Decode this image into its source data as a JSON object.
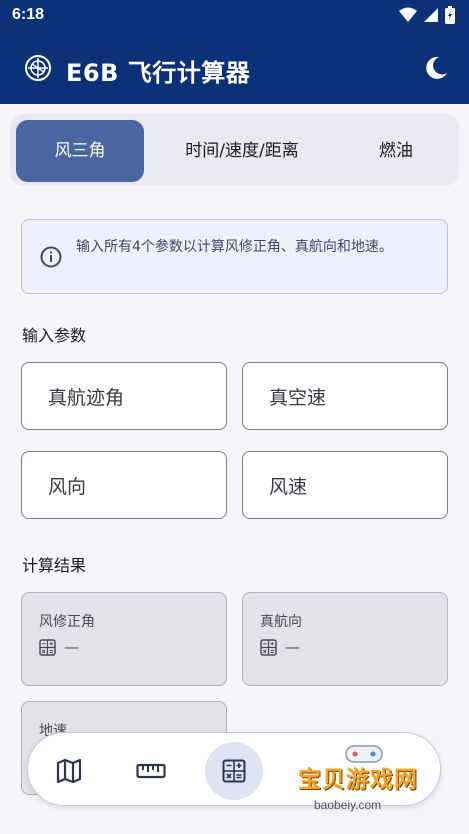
{
  "status_bar": {
    "time": "6:18"
  },
  "app": {
    "title": "E6B 飞行计算器"
  },
  "tabs": [
    {
      "label": "风三角",
      "active": true
    },
    {
      "label": "时间/速度/距离",
      "active": false
    },
    {
      "label": "燃油",
      "active": false
    }
  ],
  "info": {
    "text": "输入所有4个参数以计算风修正角、真航向和地速。"
  },
  "inputs": {
    "section_label": "输入参数",
    "fields": [
      {
        "placeholder": "真航迹角"
      },
      {
        "placeholder": "真空速"
      },
      {
        "placeholder": "风向"
      },
      {
        "placeholder": "风速"
      }
    ]
  },
  "results": {
    "section_label": "计算结果",
    "items": [
      {
        "label": "风修正角",
        "value": "—"
      },
      {
        "label": "真航向",
        "value": "—"
      },
      {
        "label": "地速",
        "value": "—"
      }
    ]
  },
  "bottom_nav": [
    {
      "icon": "map-icon",
      "active": false
    },
    {
      "icon": "ruler-icon",
      "active": false
    },
    {
      "icon": "calculator-icon",
      "active": true
    }
  ],
  "watermark": {
    "text": "宝贝游戏网",
    "url": "baobeiy.com"
  },
  "colors": {
    "primary": "#0d3178",
    "tab_active": "#4a66a0",
    "info_bg": "#eef0fb"
  }
}
